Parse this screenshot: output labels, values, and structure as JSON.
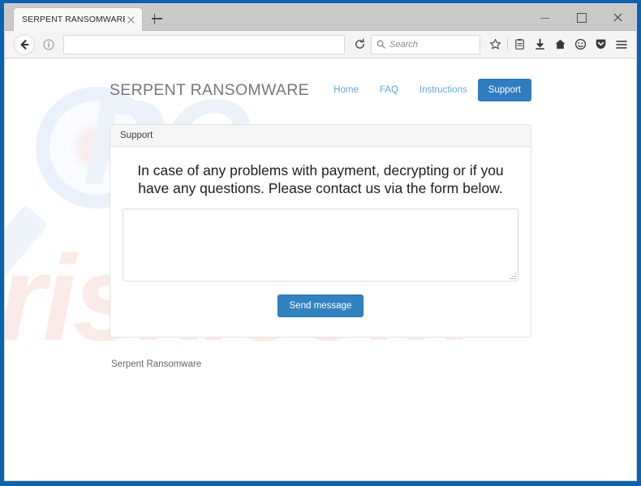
{
  "browser": {
    "tab_title": "SERPENT RANSOMWARE",
    "url_value": "",
    "search_placeholder": "Search",
    "icons": {
      "back": "back-arrow-icon",
      "info": "info-icon",
      "reload": "reload-icon",
      "search": "search-icon",
      "bookmark": "star-icon",
      "library": "library-icon",
      "downloads": "download-arrow-icon",
      "home": "home-icon",
      "sync": "sync-account-icon",
      "pocket": "pocket-icon",
      "menu": "hamburger-menu-icon",
      "new_tab": "plus-icon",
      "tab_close": "close-icon",
      "minimize": "minimize-icon",
      "maximize": "maximize-icon",
      "close": "close-window-icon"
    }
  },
  "site": {
    "brand": "SERPENT RANSOMWARE",
    "nav": [
      {
        "label": "Home",
        "active": false
      },
      {
        "label": "FAQ",
        "active": false
      },
      {
        "label": "Instructions",
        "active": false
      },
      {
        "label": "Support",
        "active": true
      }
    ],
    "panel": {
      "heading": "Support",
      "message": "In case of any problems with payment, decrypting or if you have any questions. Please contact us via the form below.",
      "textarea_value": "",
      "textarea_placeholder": "",
      "send_button": "Send message"
    },
    "footer": "Serpent Ransomware",
    "watermark": {
      "line1": "PC",
      "line2": "risk.com"
    }
  },
  "colors": {
    "window_frame": "#0b63ad",
    "accent_blue": "#2f7cc0",
    "nav_link": "#62a8e0",
    "button_blue": "#3182c1",
    "brand_gray": "#777777"
  }
}
